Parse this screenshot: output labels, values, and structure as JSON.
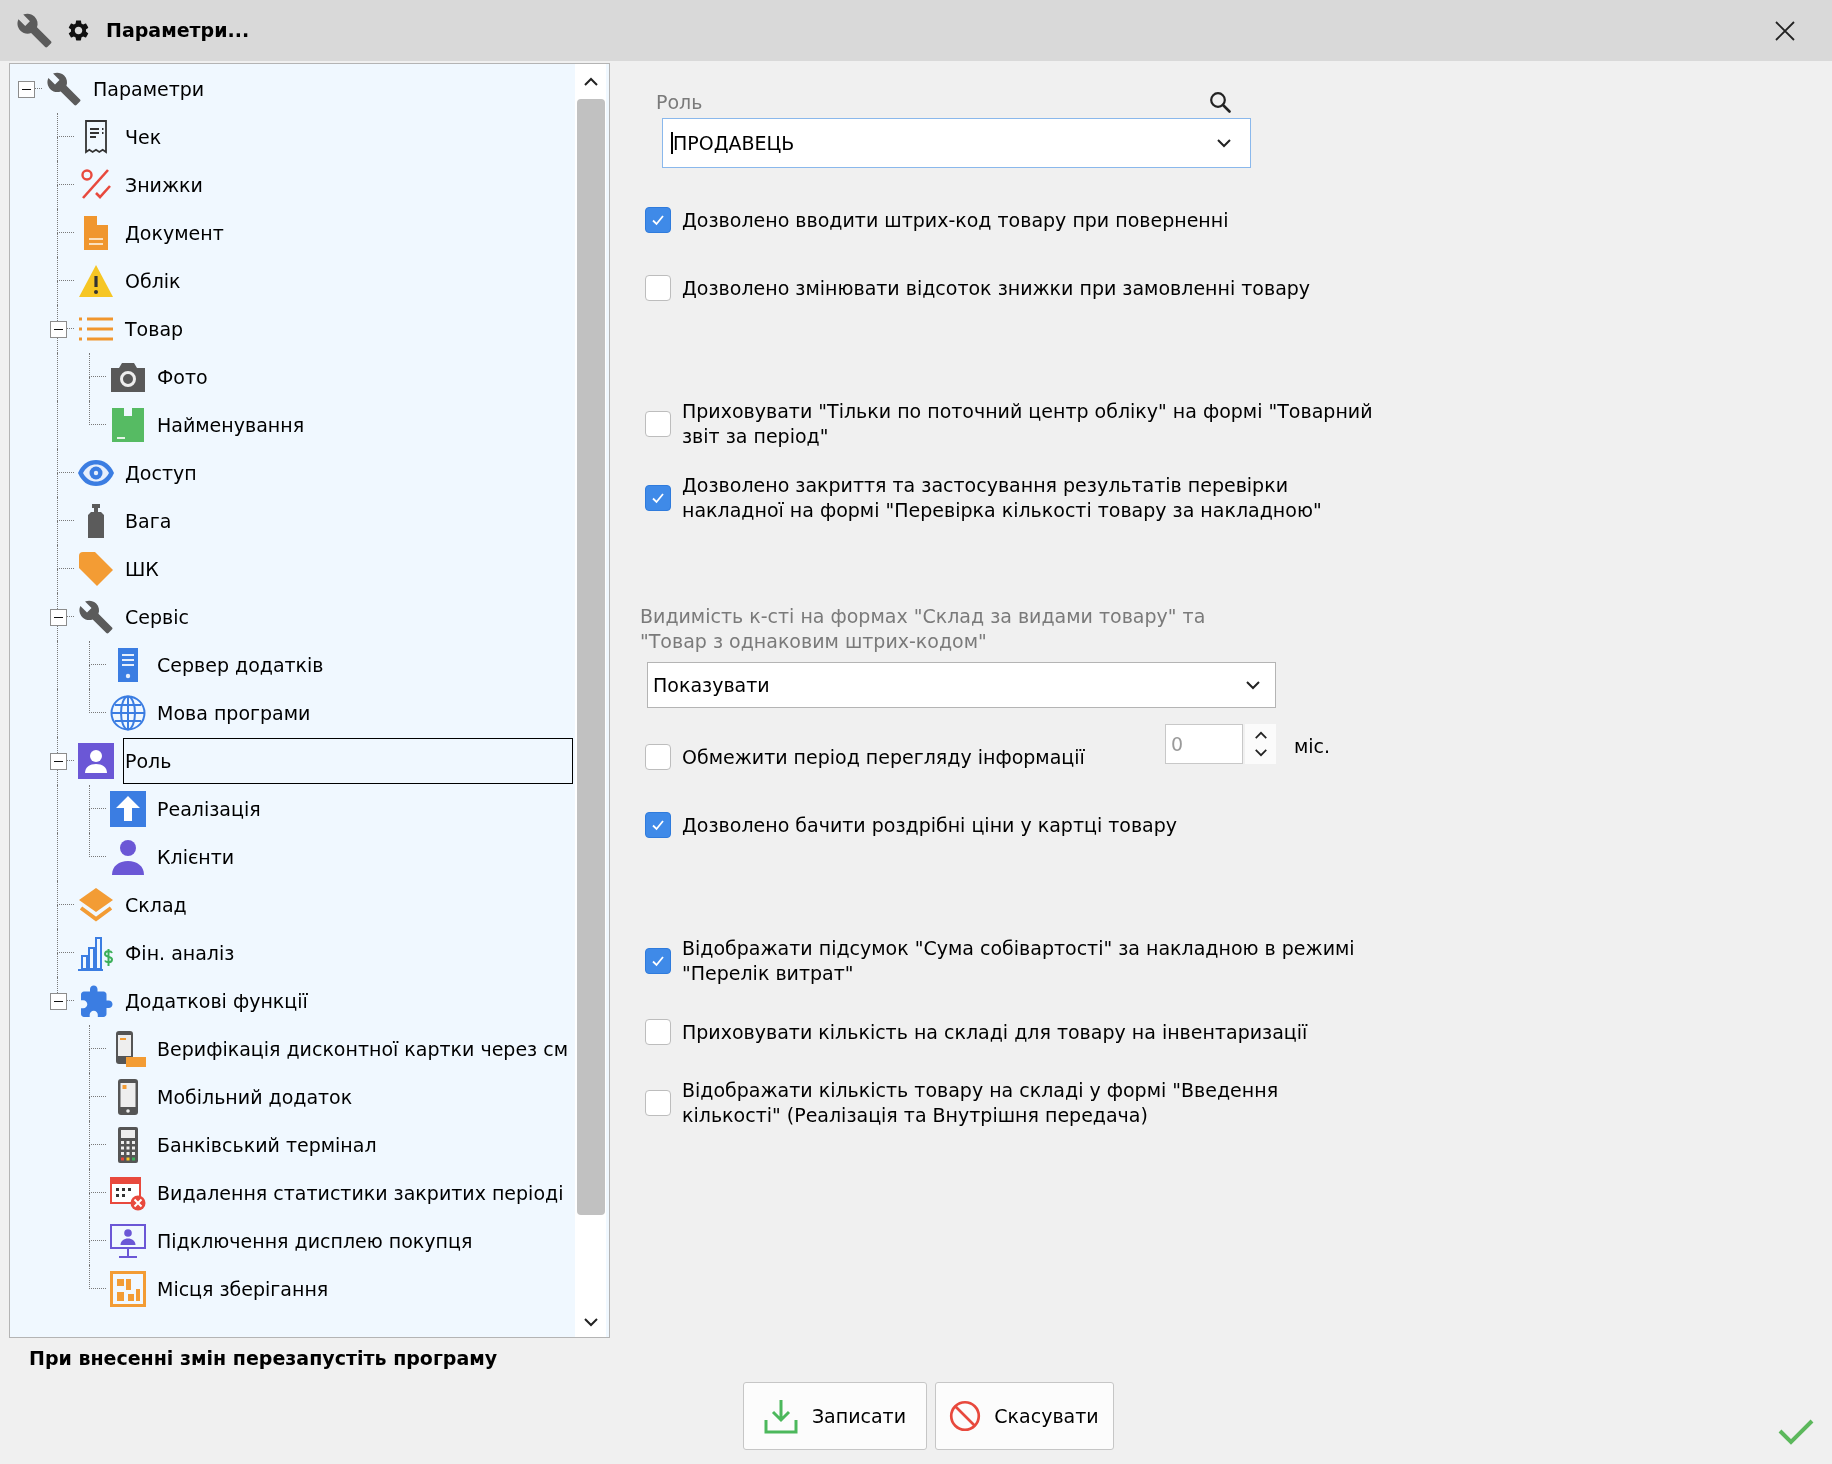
{
  "window": {
    "title": "Параметри..."
  },
  "tree": {
    "items": [
      {
        "label": "Параметри",
        "selected": false,
        "expanded": true,
        "children": [
          {
            "label": "Чек",
            "selected": false
          },
          {
            "label": "Знижки",
            "selected": false
          },
          {
            "label": "Документ",
            "selected": false
          },
          {
            "label": "Облік",
            "selected": false
          },
          {
            "label": "Товар",
            "selected": false,
            "expanded": true,
            "children": [
              {
                "label": "Фото",
                "selected": false
              },
              {
                "label": "Найменування",
                "selected": false
              }
            ]
          },
          {
            "label": "Доступ",
            "selected": false
          },
          {
            "label": "Вага",
            "selected": false
          },
          {
            "label": "ШК",
            "selected": false
          },
          {
            "label": "Сервіс",
            "selected": false,
            "expanded": true,
            "children": [
              {
                "label": "Сервер додатків",
                "selected": false
              },
              {
                "label": "Мова програми",
                "selected": false
              }
            ]
          },
          {
            "label": "Роль",
            "selected": true,
            "expanded": true,
            "children": [
              {
                "label": "Реалізація",
                "selected": false
              },
              {
                "label": "Клієнти",
                "selected": false
              }
            ]
          },
          {
            "label": "Склад",
            "selected": false
          },
          {
            "label": "Фін. аналіз",
            "selected": false
          },
          {
            "label": "Додаткові функції",
            "selected": false,
            "expanded": true,
            "children": [
              {
                "label": "Верифікація дисконтної картки через см",
                "selected": false
              },
              {
                "label": "Мобільний додаток",
                "selected": false
              },
              {
                "label": "Банківський термінал",
                "selected": false
              },
              {
                "label": "Видалення статистики закритих періоді",
                "selected": false
              },
              {
                "label": "Підключення дисплею покупця",
                "selected": false
              },
              {
                "label": "Місця зберігання",
                "selected": false
              }
            ]
          }
        ]
      }
    ]
  },
  "settings": {
    "groups": [
      {
        "items": [
          {
            "kind": "lookup",
            "label": "Роль",
            "value": "ПРОДАВЕЦЬ",
            "focused": true
          },
          {
            "kind": "checkbox",
            "label": "Дозволено вводити штрих-код товару при поверненні",
            "checked": true
          },
          {
            "kind": "checkbox",
            "label": "Дозволено змінювати відсоток знижки при замовленні товару",
            "checked": false
          }
        ]
      },
      {
        "items": [
          {
            "kind": "checkbox",
            "label": "Приховувати \"Тільки по поточний центр обліку\" на формі \"Товарний звіт за період\"",
            "checked": false
          },
          {
            "kind": "checkbox",
            "label": "Дозволено закриття та застосування результатів перевірки накладної на формі \"Перевірка кількості товару за накладною\"",
            "checked": true
          }
        ]
      },
      {
        "items": [
          {
            "kind": "select",
            "label": "Видимість к-сті на формах \"Склад за видами товару\" та \"Товар з однаковим штрих-кодом\"",
            "value": "Показувати",
            "focused": false
          },
          {
            "kind": "checkbox_spin",
            "label": "Обмежити період перегляду інформації",
            "checked": false,
            "spin": {
              "value": "0",
              "disabled": true
            },
            "unit": "міс."
          },
          {
            "kind": "checkbox",
            "label": "Дозволено бачити роздрібні ціни у картці товару",
            "checked": true
          }
        ]
      },
      {
        "items": [
          {
            "kind": "checkbox",
            "label": "Відображати підсумок \"Сума собівартості\" за накладною в режимі \"Перелік витрат\"",
            "checked": true
          },
          {
            "kind": "checkbox",
            "label": "Приховувати кількість на складі для товару на інвентаризації",
            "checked": false
          },
          {
            "kind": "checkbox",
            "label": "Відображати кількість товару на складі у формі \"Введення кількості\" (Реалізація та Внутрішня передача)",
            "checked": false
          }
        ]
      }
    ]
  },
  "footer": {
    "notice": "При внесенні змін перезапустіть програму",
    "buttons": [
      {
        "kind": "save",
        "label": "Записати"
      },
      {
        "kind": "cancel",
        "label": "Скасувати"
      }
    ]
  }
}
